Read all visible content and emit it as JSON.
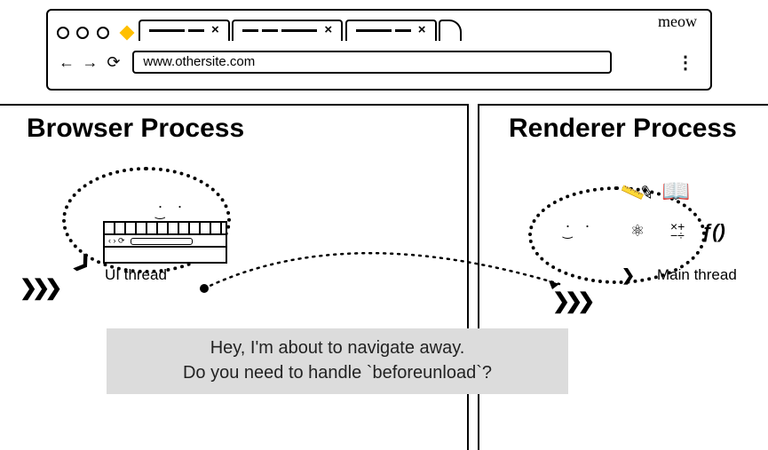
{
  "browser_chrome": {
    "meow_label": "meow",
    "url": "www.othersite.com",
    "nav": {
      "back": "←",
      "forward": "→",
      "reload": "⟳"
    },
    "kebab": "⋮"
  },
  "processes": {
    "browser": {
      "title": "Browser Process",
      "thread_label": "UI thread"
    },
    "renderer": {
      "title": "Renderer Process",
      "thread_label": "Main thread"
    }
  },
  "message": {
    "line1": "Hey, I'm about to navigate away.",
    "line2": "Do you need to handle `beforeunload`?"
  },
  "icons": {
    "face": ".  .",
    "fx": "ƒ()"
  }
}
